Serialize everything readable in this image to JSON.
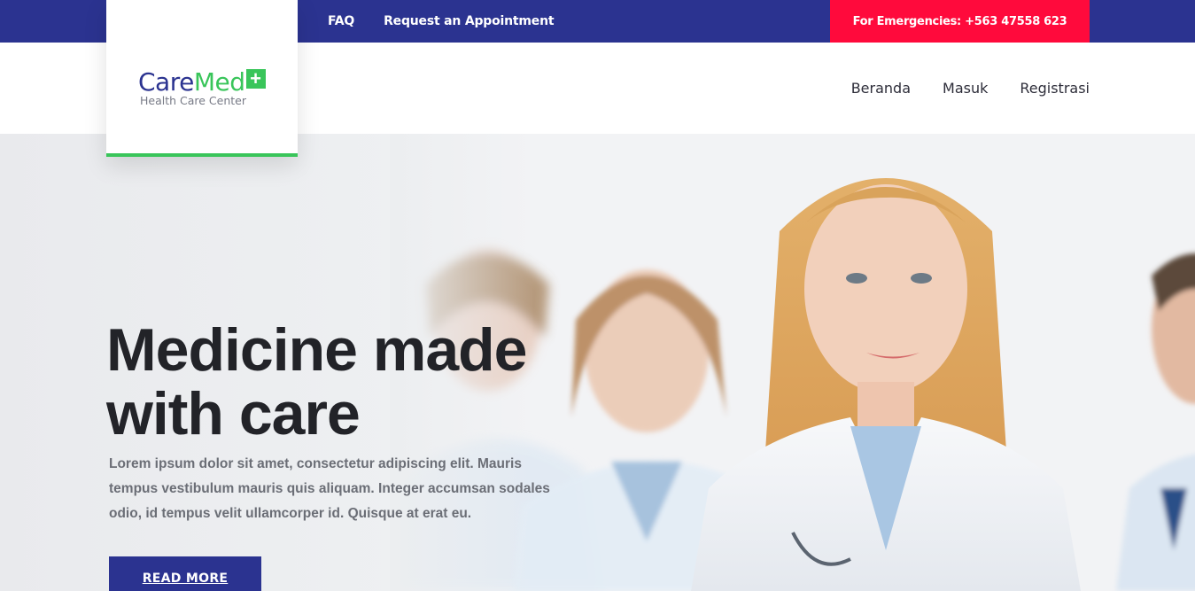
{
  "topbar": {
    "links": [
      "FAQ",
      "Request an Appointment"
    ],
    "emergency": "For Emergencies: +563 47558 623"
  },
  "logo": {
    "care": "Care",
    "med": "Med",
    "plus": "+",
    "subtitle": "Health Care Center"
  },
  "nav": {
    "items": [
      "Beranda",
      "Masuk",
      "Registrasi"
    ]
  },
  "hero": {
    "headline_line1": "Medicine made",
    "headline_line2": "with care",
    "text": "Lorem ipsum dolor sit amet, consectetur adipiscing elit. Mauris tempus vestibulum mauris quis aliquam. Integer accumsan sodales odio, id tempus velit ullamcorper id. Quisque at erat eu.",
    "button": "READ MORE"
  },
  "colors": {
    "primary": "#2b3390",
    "accent_green": "#39c55a",
    "emergency_red": "#ff0a3c"
  }
}
